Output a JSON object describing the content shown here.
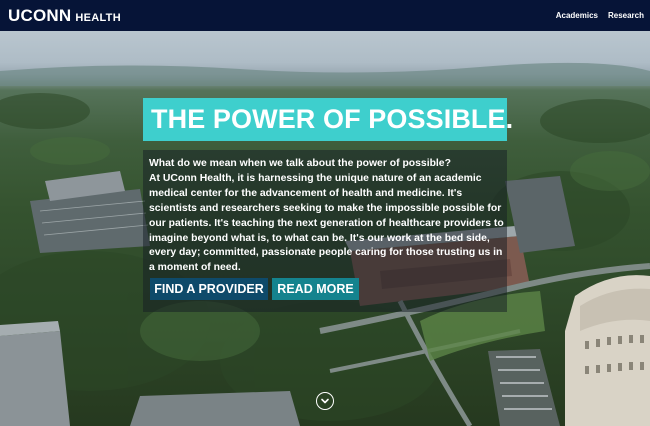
{
  "header": {
    "brand": "UCONN",
    "brand_sub": "HEALTH",
    "nav": [
      "Academics",
      "Research"
    ]
  },
  "hero": {
    "headline": "THE POWER OF POSSIBLE.",
    "paragraphs": [
      "What do we mean when we talk about the power of possible?",
      "At UConn Health, it is harnessing the unique nature of an academic medical center for the advancement of health and medicine. It's scientists and researchers seeking to make the impossible possible for our patients. It's teaching the next generation of healthcare providers to imagine beyond what is, to what can be. It's our work at the bed side, every day; committed, passionate people caring for those trusting us in a moment of need."
    ],
    "buttons": {
      "find_provider": "FIND A PROVIDER",
      "read_more": "READ MORE"
    },
    "scroll_icon": "chevron-down-circle-icon"
  },
  "colors": {
    "header_bg": "#061437",
    "headline_bg": "#3ecfcd",
    "find_provider_bg": "#0e4a6a",
    "read_more_bg": "#14838e"
  }
}
